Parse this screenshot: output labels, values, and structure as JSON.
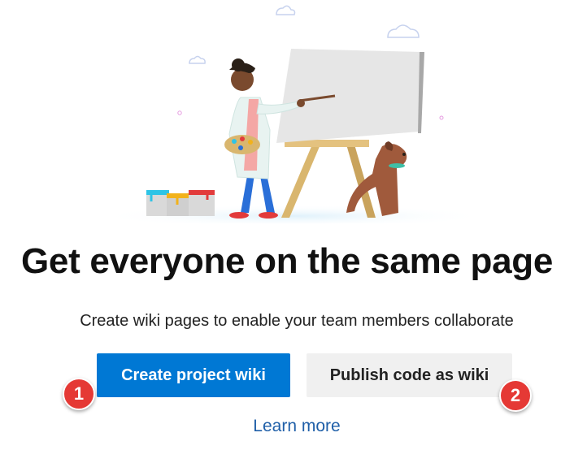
{
  "hero": {
    "illustration": "painter-with-easel-and-dog-illustration",
    "colors": {
      "sky_cloud": "#c7d2ee",
      "canvas": "#e6e6e6",
      "easel": "#d9b66e",
      "dog": "#a05a3c",
      "coat": "#e8f3f1",
      "paint_cyan": "#2ec4e6",
      "paint_yellow": "#f2b21b",
      "paint_red": "#e23b3b"
    }
  },
  "headline": "Get everyone on the same page",
  "subtitle": "Create wiki pages to enable your team members collaborate",
  "actions": {
    "create_label": "Create project wiki",
    "publish_label": "Publish code as wiki",
    "learn_more_label": "Learn more"
  },
  "badges": {
    "one": "1",
    "two": "2"
  },
  "colors": {
    "primary": "#0078d4",
    "secondary_bg": "#f0f0f0",
    "badge": "#e53935",
    "link": "#1f5fa8"
  }
}
